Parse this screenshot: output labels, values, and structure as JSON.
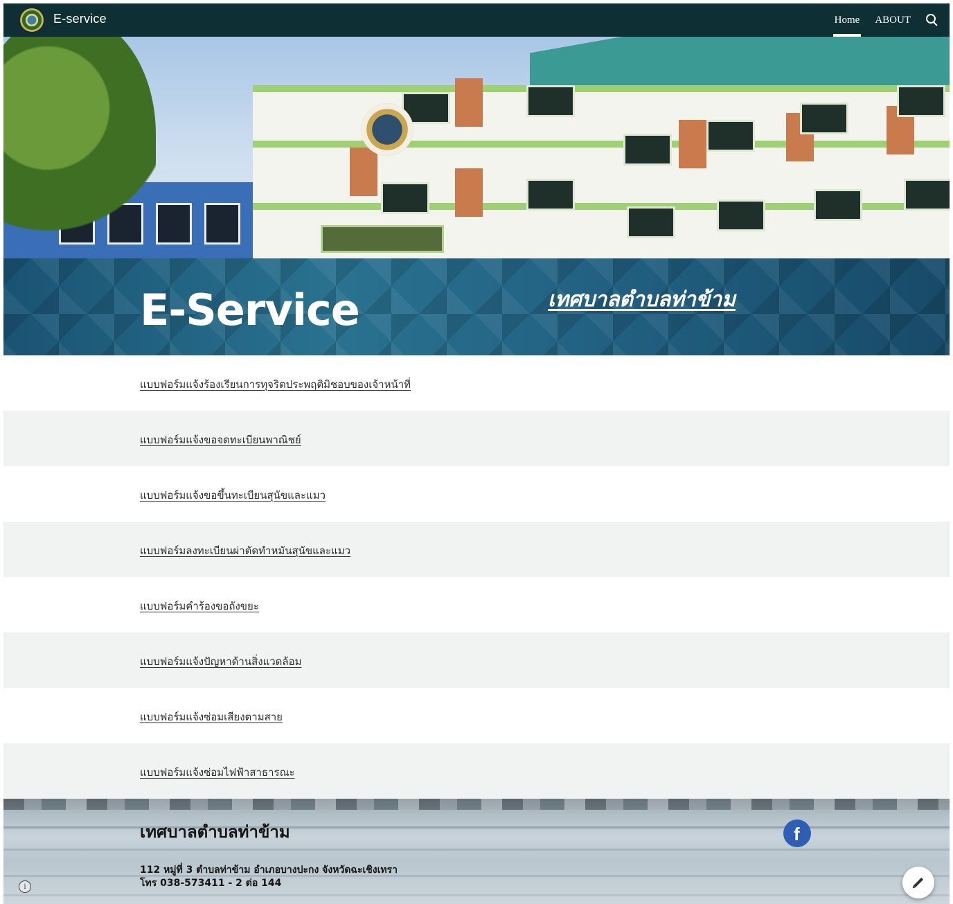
{
  "header": {
    "site_title": "E-service",
    "nav": [
      {
        "label": "Home",
        "active": true
      },
      {
        "label": "ABOUT",
        "active": false
      }
    ],
    "search_icon": "search-icon"
  },
  "banner": {
    "title": "E-Service",
    "subtitle": "เทศบาลตำบลท่าข้าม"
  },
  "forms": [
    {
      "label": "แบบฟอร์มแจ้งร้องเรียนการทุจริตประพฤติมิชอบของเจ้าหน้าที่"
    },
    {
      "label": "แบบฟอร์มแจ้งขอจดทะเบียนพาณิชย์"
    },
    {
      "label": "แบบฟอร์มแจ้งขอขึ้นทะเบียนสุนัขและแมว"
    },
    {
      "label": "แบบฟอร์มลงทะเบียนผ่าตัดทำหมันสุนัขและแมว"
    },
    {
      "label": "แบบฟอร์มคำร้องขอถังขยะ"
    },
    {
      "label": "แบบฟอร์มแจ้งปัญหาด้านสิ่งแวดล้อม"
    },
    {
      "label": "แบบฟอร์มแจ้งซ่อมเสียงตามสาย"
    },
    {
      "label": "แบบฟอร์มแจ้งซ่อมไฟฟ้าสาธารณะ"
    }
  ],
  "footer": {
    "title": "เทศบาลตำบลท่าข้าม",
    "address_line1": "112 หมู่ที่ 3 ตำบลท่าข้าม อำเภอบางปะกง จังหวัดฉะเชิงเทรา",
    "address_line2": "โทร 038-573411 - 2 ต่อ 144",
    "facebook_icon_glyph": "f",
    "info_icon_glyph": "i"
  },
  "colors": {
    "topbar": "#0e2f33",
    "banner": "#1d5a7a",
    "shaded_row": "#f1f2f2",
    "facebook": "#2f5fb4"
  }
}
